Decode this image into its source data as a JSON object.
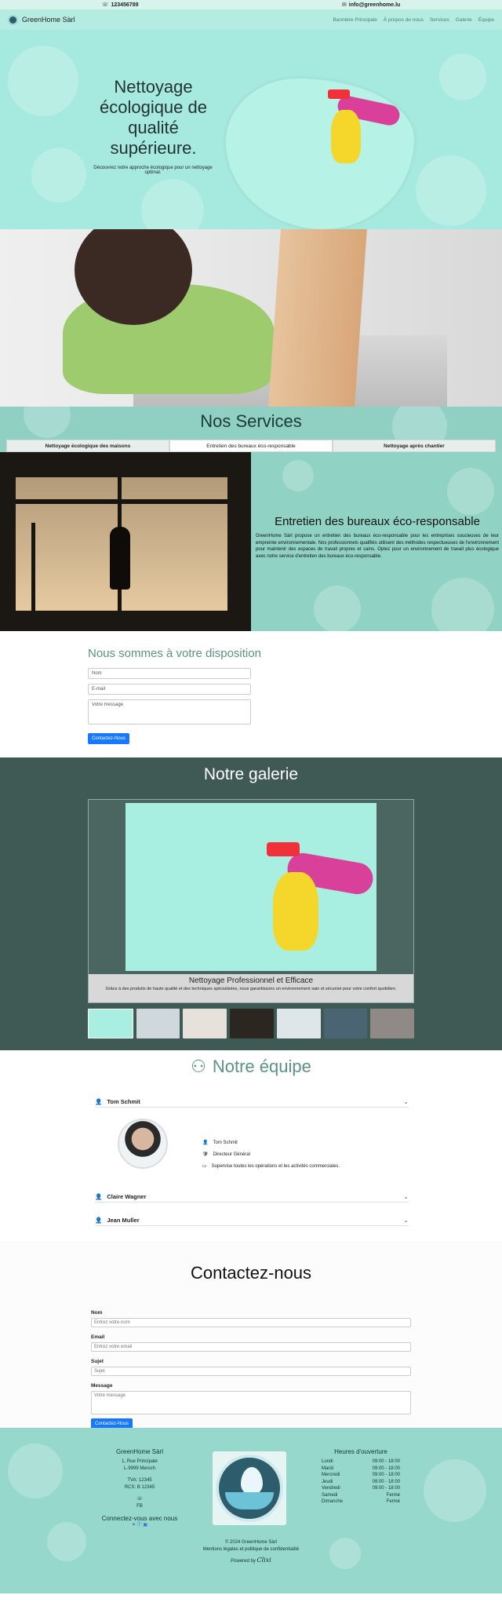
{
  "topbar": {
    "phone": "123456789",
    "email": "info@greenhome.lu"
  },
  "nav": {
    "brand": "GreenHome Sàrl",
    "links": [
      "Bannière Principale",
      "À propos de nous",
      "Services",
      "Galerie",
      "Équipe"
    ]
  },
  "hero": {
    "title": "Nettoyage écologique de qualité supérieure.",
    "subtitle": "Découvrez notre approche écologique pour un nettoyage optimal."
  },
  "services": {
    "title": "Nos Services",
    "tabs": [
      "Nettoyage écologique des maisons",
      "Entretien des bureaux éco-responsable",
      "Nettoyage après chantier"
    ],
    "active_tab": 1,
    "active_title": "Entretien des bureaux éco-responsable",
    "active_text": "GreenHome Sàrl propose un entretien des bureaux éco-responsable pour les entreprises soucieuses de leur empreinte environnementale. Nos professionnels qualifiés utilisent des méthodes respectueuses de l'environnement pour maintenir des espaces de travail propres et sains. Optez pour un environnement de travail plus écologique avec notre service d'entretien des bureaux éco-responsable."
  },
  "dispo_form": {
    "title": "Nous sommes à votre disposition",
    "name_placeholder": "Nom",
    "email_placeholder": "E-mail",
    "message_placeholder": "Votre message",
    "submit_label": "Contactez-Nous"
  },
  "gallery": {
    "title": "Notre galerie",
    "caption_title": "Nettoyage Professionnel et Efficace",
    "caption_text": "Grâce à des produits de haute qualité et des techniques spécialisées, nous garantissons un environnement sain et sécurisé pour votre confort quotidien.",
    "thumb_colors": [
      "#a9efe1",
      "#cfd8dc",
      "#e6e1da",
      "#2c2620",
      "#dfe6ea",
      "#4b6474",
      "#8f8a86"
    ]
  },
  "team": {
    "title": "Notre équipe",
    "members": [
      {
        "name": "Tom Schmit",
        "role": "Directeur Général",
        "description": "Supervise toutes les opérations et les activités commerciales.",
        "expanded": true
      },
      {
        "name": "Claire Wagner",
        "expanded": false
      },
      {
        "name": "Jean Muller",
        "expanded": false
      }
    ]
  },
  "contact": {
    "title": "Contactez-nous",
    "fields": [
      {
        "label": "Nom",
        "placeholder": "Entrez votre nom"
      },
      {
        "label": "Email",
        "placeholder": "Entrez votre email"
      },
      {
        "label": "Sujet",
        "placeholder": "Sujet"
      },
      {
        "label": "Message",
        "placeholder": "Votre message"
      }
    ],
    "submit_label": "Contactez-Nous"
  },
  "footer": {
    "company": "GreenHome Sàrl",
    "address_line1": "1, Rue Principale",
    "address_line2": "L-9999 Mersch",
    "tva": "TVA: 12345",
    "rcs": "RCS: B 12345",
    "phone_short": "☏",
    "fb": "FB",
    "social_title": "Connectez-vous avec nous",
    "hours_title": "Heures d'ouverture",
    "hours": [
      {
        "day": "Lundi",
        "time": "09:00 - 18:00"
      },
      {
        "day": "Mardi",
        "time": "09:00 - 18:00"
      },
      {
        "day": "Mercredi",
        "time": "09:00 - 18:00"
      },
      {
        "day": "Jeudi",
        "time": "09:00 - 18:00"
      },
      {
        "day": "Vendredi",
        "time": "09:00 - 18:00"
      },
      {
        "day": "Samedi",
        "time": "Fermé"
      },
      {
        "day": "Dimanche",
        "time": "Fermé"
      }
    ],
    "copyright": "© 2024 GreenHome Sàrl",
    "legal": "Mentions légales et politique de confidentialité",
    "powered_by": "Powered by",
    "powered_brand": "Clixi"
  }
}
